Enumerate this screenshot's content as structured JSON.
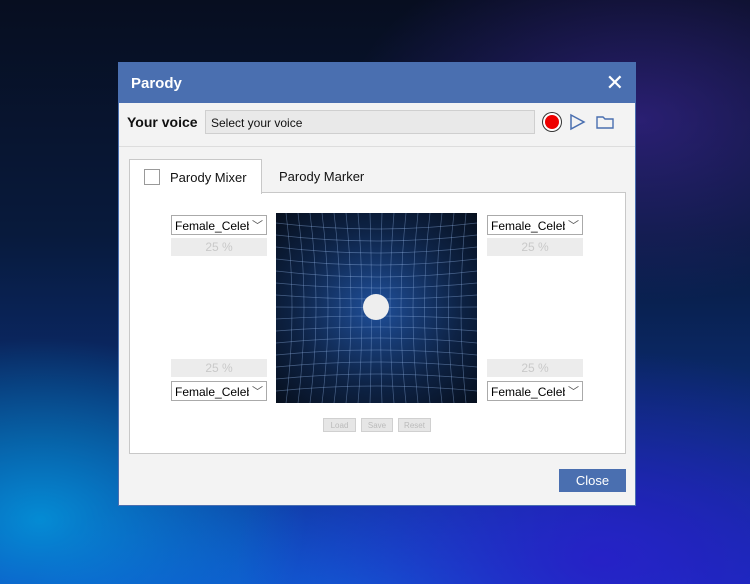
{
  "dialog": {
    "title": "Parody",
    "close_icon": "close-icon",
    "voice_label": "Your voice",
    "voice_placeholder": "Select your voice",
    "icons": [
      "record-icon",
      "play-icon",
      "folder-icon"
    ],
    "colors": {
      "titlebar": "#4a6fb0",
      "record": "#ee0000",
      "accent_icons": "#4a6fb0"
    }
  },
  "tabs": [
    {
      "label": "Parody Mixer",
      "active": true
    },
    {
      "label": "Parody Marker",
      "active": false
    }
  ],
  "mixer": {
    "top_left": {
      "voice": "Female_Celebrity",
      "percent": "25 %"
    },
    "top_right": {
      "voice": "Female_Celebrity",
      "percent": "25 %"
    },
    "bottom_left": {
      "voice": "Female_Celebrity",
      "percent": "25 %"
    },
    "bottom_right": {
      "voice": "Female_Celebrity",
      "percent": "25 %"
    },
    "buttons": [
      "Load",
      "Save",
      "Reset"
    ]
  },
  "footer": {
    "close_label": "Close"
  }
}
